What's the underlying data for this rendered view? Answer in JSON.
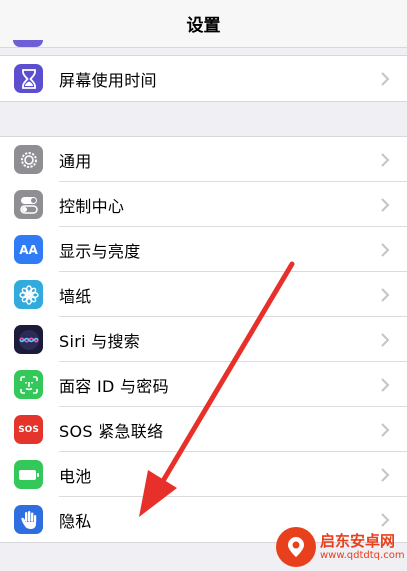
{
  "nav": {
    "title": "设置"
  },
  "colors": {
    "screen_time": "#5b4fcf",
    "general": "#8e8e93",
    "control_center": "#8e8e93",
    "display": "#2f7cf6",
    "wallpaper": "#33aadc",
    "siri": "#1c1c3a",
    "faceid": "#34c759",
    "sos": "#e5342b",
    "battery": "#34c759",
    "privacy": "#2f6ee0",
    "annotation_arrow": "#e8302b"
  },
  "group1": {
    "items": [
      {
        "label": "屏幕使用时间",
        "icon": "hourglass-icon"
      }
    ]
  },
  "group2": {
    "items": [
      {
        "label": "通用",
        "icon": "gear-icon"
      },
      {
        "label": "控制中心",
        "icon": "toggles-icon"
      },
      {
        "label": "显示与亮度",
        "icon": "text-size-icon",
        "icon_text": "AA"
      },
      {
        "label": "墙纸",
        "icon": "flower-icon"
      },
      {
        "label": "Siri 与搜索",
        "icon": "siri-icon"
      },
      {
        "label": "面容 ID 与密码",
        "icon": "face-id-icon"
      },
      {
        "label": "SOS 紧急联络",
        "icon": "sos-icon",
        "icon_text": "SOS"
      },
      {
        "label": "电池",
        "icon": "battery-icon"
      },
      {
        "label": "隐私",
        "icon": "hand-icon"
      }
    ]
  },
  "watermark": {
    "title": "启东安卓网",
    "url": "www.qdtdtq.com"
  }
}
